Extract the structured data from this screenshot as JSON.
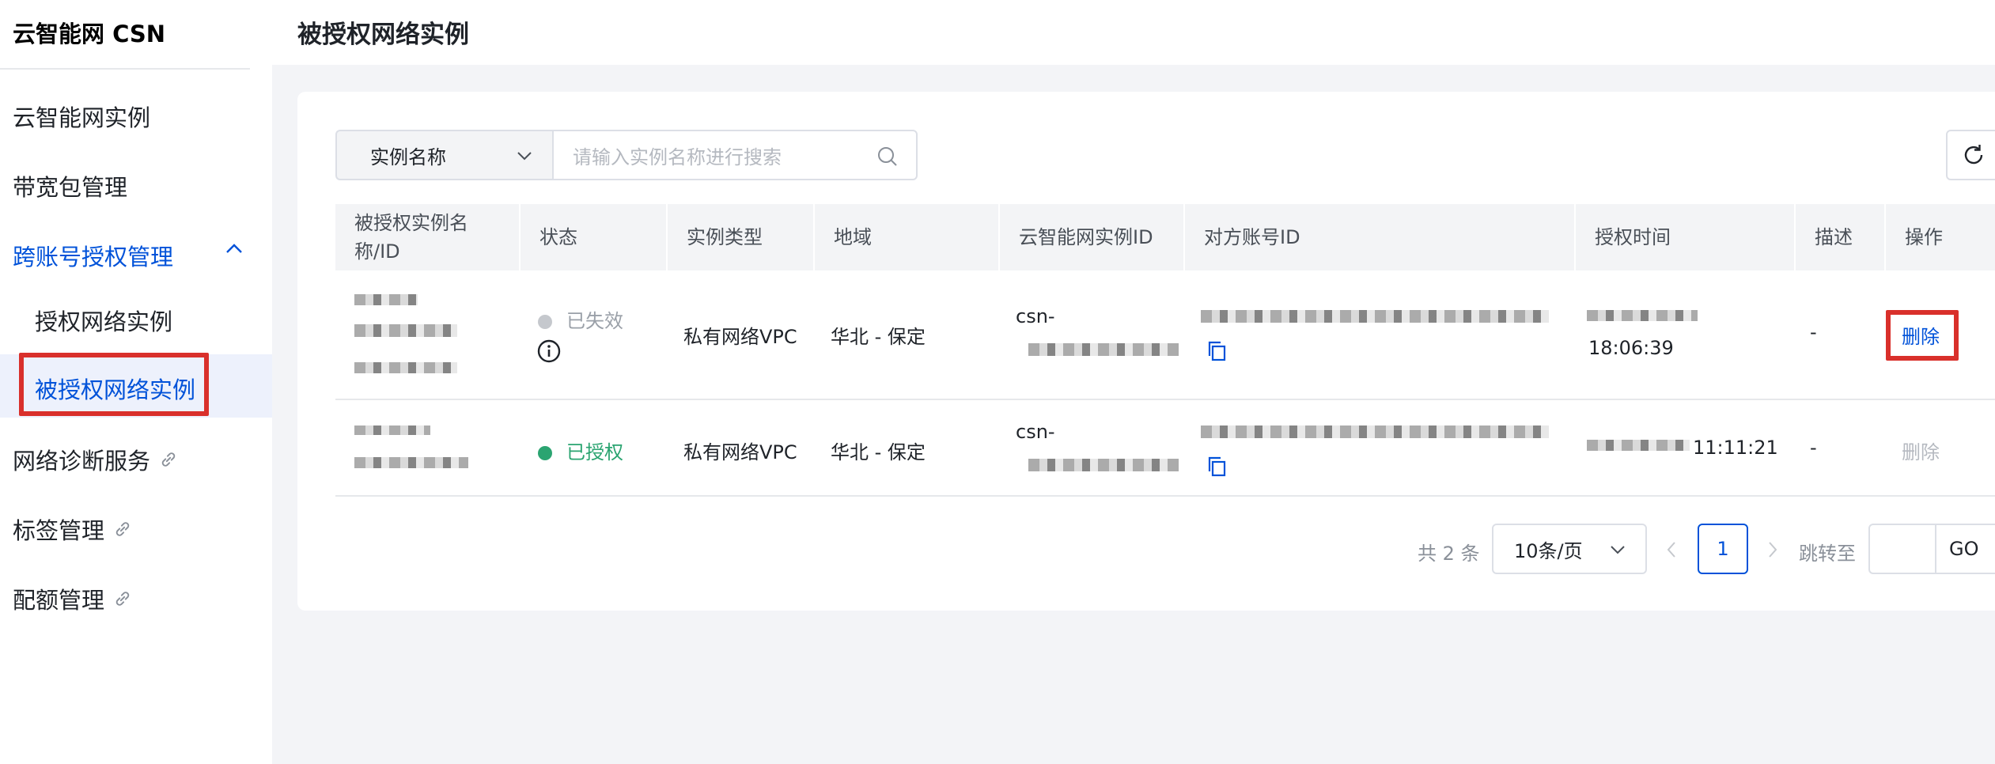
{
  "sidebar": {
    "brand": "云智能网 CSN",
    "items": [
      {
        "label": "云智能网实例"
      },
      {
        "label": "带宽包管理"
      },
      {
        "label": "跨账号授权管理"
      },
      {
        "label": "授权网络实例"
      },
      {
        "label": "被授权网络实例"
      },
      {
        "label": "网络诊断服务"
      },
      {
        "label": "标签管理"
      },
      {
        "label": "配额管理"
      }
    ]
  },
  "page": {
    "title": "被授权网络实例"
  },
  "search": {
    "field_select": "实例名称",
    "placeholder": "请输入实例名称进行搜索"
  },
  "table": {
    "headers": [
      "被授权实例名称/ID",
      "状态",
      "实例类型",
      "地域",
      "云智能网实例ID",
      "对方账号ID",
      "授权时间",
      "描述",
      "操作"
    ],
    "rows": [
      {
        "status": "已失效",
        "instance_type": "私有网络VPC",
        "region": "华北 - 保定",
        "csn_id_prefix": "csn-",
        "auth_time": "18:06:39",
        "description": "-",
        "action": "删除"
      },
      {
        "status": "已授权",
        "instance_type": "私有网络VPC",
        "region": "华北 - 保定",
        "csn_id_prefix": "csn-",
        "auth_time": "11:11:21",
        "description": "-",
        "action": "删除"
      }
    ]
  },
  "pagination": {
    "total": "共 2 条",
    "page_size": "10条/页",
    "current_page": "1",
    "jump_label": "跳转至",
    "go": "GO"
  },
  "colors": {
    "accent": "#0052d9",
    "success": "#2ba471",
    "muted": "#9aa0a8",
    "highlight_box": "#d9302b"
  }
}
